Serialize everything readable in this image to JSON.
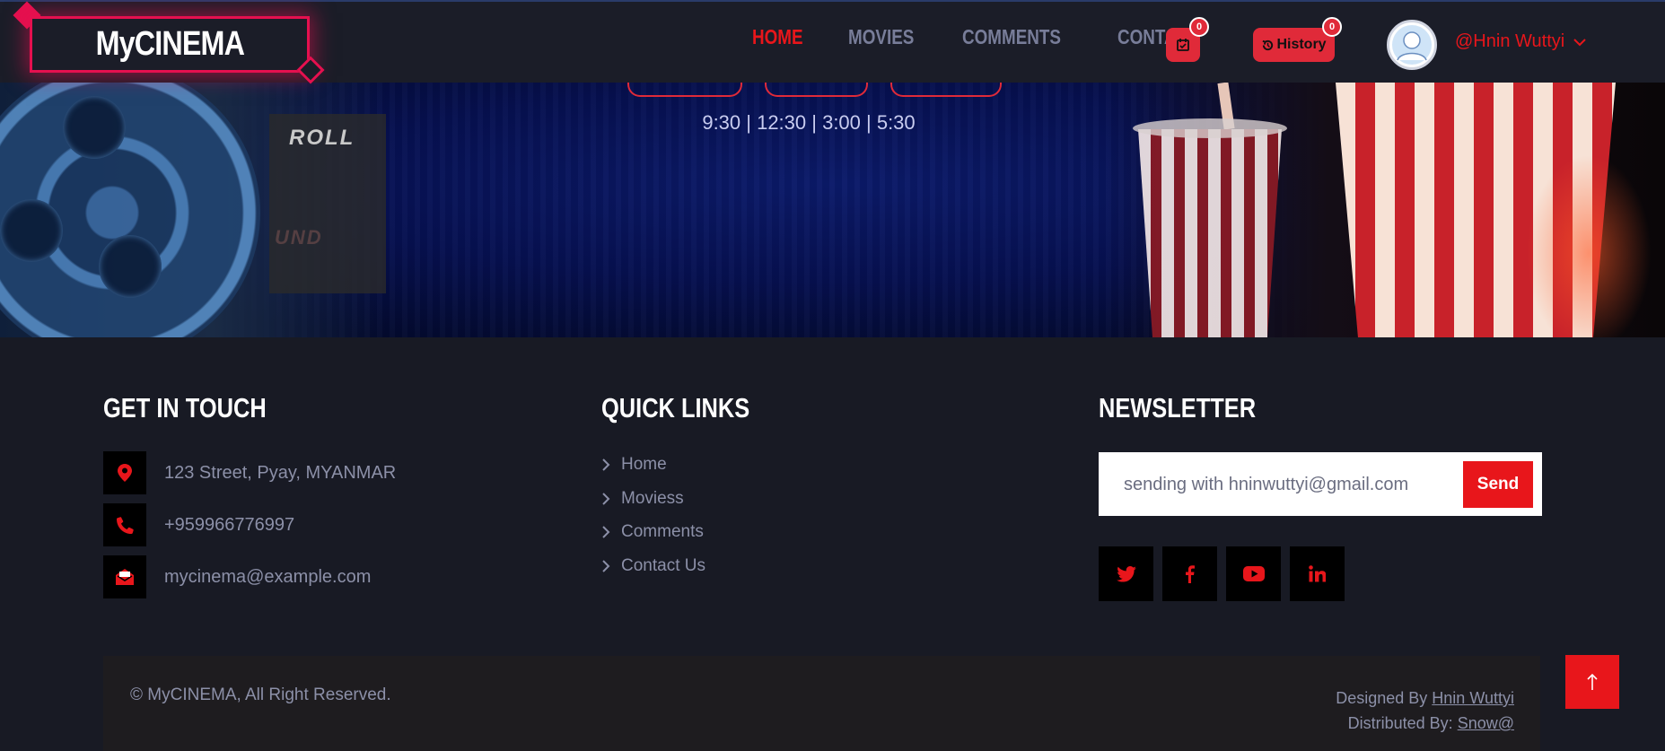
{
  "brand": {
    "logo_text": "MyCINEMA"
  },
  "nav": {
    "links": [
      "HOME",
      "MOVIES",
      "COMMENTS",
      "CONTACT"
    ],
    "active": "HOME",
    "calendar_badge": "0",
    "history_label": "History",
    "history_badge": "0",
    "username": "@Hnin Wuttyi"
  },
  "hero": {
    "showtimes": "9:30 | 12:30 | 3:00 | 5:30",
    "clapper_text_1": "ROLL",
    "clapper_text_2": "UND"
  },
  "footer": {
    "get_in_touch": {
      "title": "GET IN TOUCH",
      "address": "123 Street, Pyay, MYANMAR",
      "phone": "+959966776997",
      "email": "mycinema@example.com"
    },
    "quick_links": {
      "title": "QUICK LINKS",
      "items": [
        "Home",
        "Moviess",
        "Comments",
        "Contact Us"
      ]
    },
    "newsletter": {
      "title": "NEWSLETTER",
      "placeholder": "sending with hninwuttyi@gmail.com",
      "button": "Send"
    },
    "copyright": "© MyCINEMA, All Right Reserved.",
    "designed_by_label": "Designed By",
    "designed_by_name": "Hnin Wuttyi",
    "distributed_by_label": "Distributed By:",
    "distributed_by_name": "Snow@"
  },
  "colors": {
    "accent": "#e8161b",
    "logo_border": "#e5104f",
    "background": "#181a24",
    "nav_text": "#787d99"
  },
  "icons": [
    "map-marker-icon",
    "phone-icon",
    "envelope-open-icon",
    "chevron-right-icon",
    "twitter-icon",
    "facebook-icon",
    "youtube-icon",
    "linkedin-icon",
    "arrow-up-icon",
    "calendar-check-icon",
    "history-icon",
    "user-avatar-icon",
    "chevron-down-icon"
  ]
}
